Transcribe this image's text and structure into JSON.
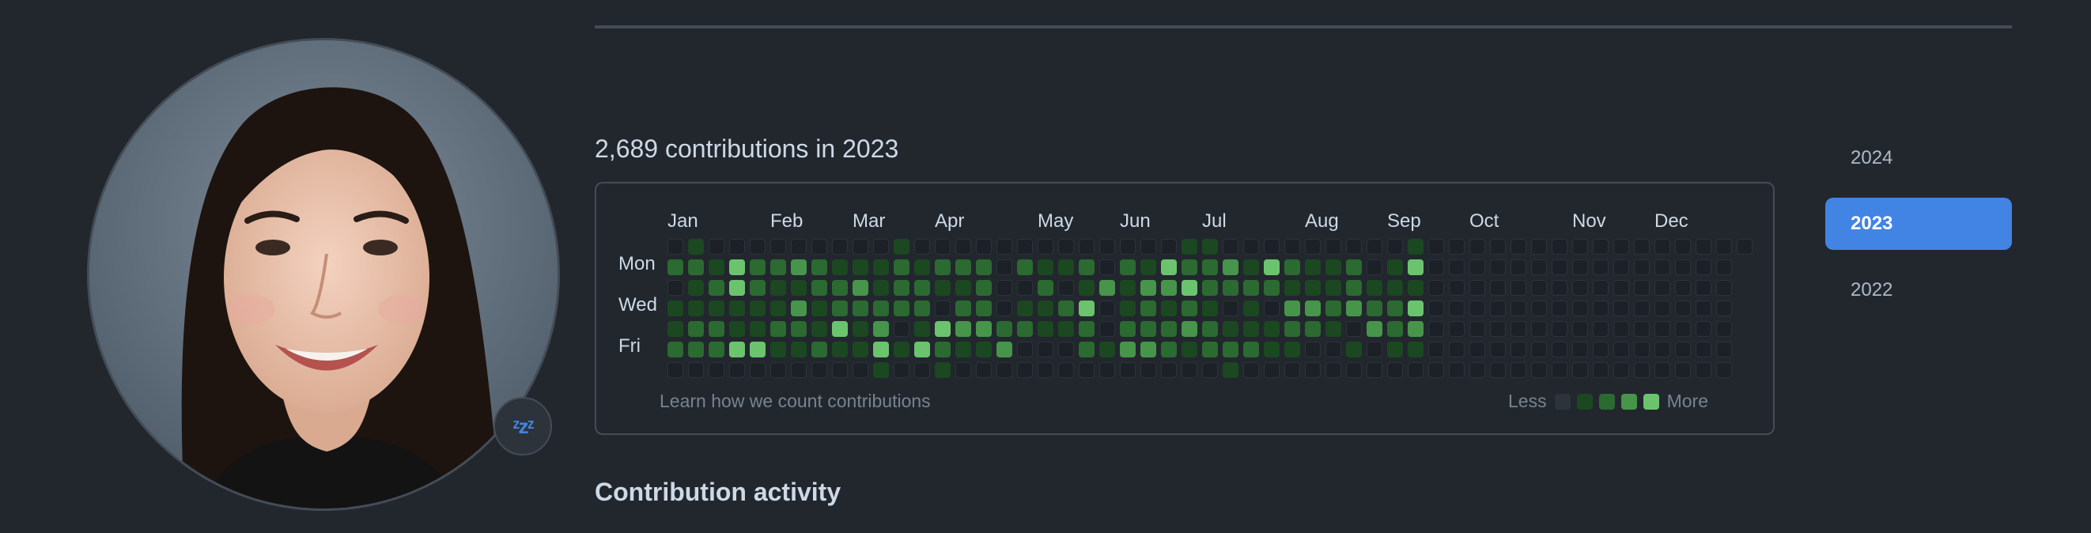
{
  "profile": {
    "status_icon": "zzz-sleeping-icon",
    "status_glyph": "ᶻzᶻ"
  },
  "contributions": {
    "title": "2,689 contributions in 2023",
    "months": [
      "Jan",
      "Feb",
      "Mar",
      "Apr",
      "May",
      "Jun",
      "Jul",
      "Aug",
      "Sep",
      "Oct",
      "Nov",
      "Dec"
    ],
    "day_labels": [
      "Mon",
      "Wed",
      "Fri"
    ],
    "learn_link": "Learn how we count contributions",
    "legend_less": "Less",
    "legend_more": "More",
    "levels_colors": [
      "#2d333b",
      "#1b4721",
      "#2b6a30",
      "#46954a",
      "#6bc46d"
    ]
  },
  "activity": {
    "title": "Contribution activity"
  },
  "years": {
    "items": [
      "2024",
      "2023",
      "2022"
    ],
    "selected": "2023"
  }
}
